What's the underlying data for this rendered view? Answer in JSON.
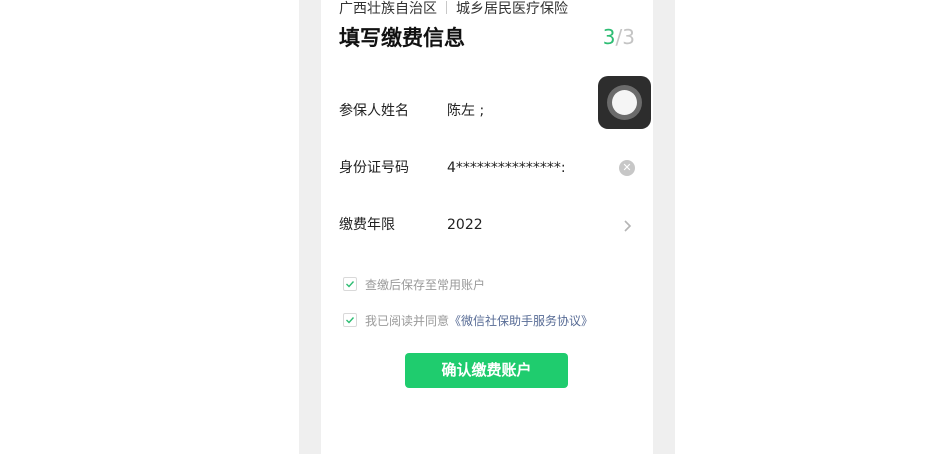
{
  "header": {
    "region": "广西壮族自治区",
    "service": "城乡居民医疗保险",
    "title": "填写缴费信息",
    "step_current": "3",
    "step_total": "/3"
  },
  "form": {
    "fields": [
      {
        "label": "参保人姓名",
        "value": "陈左 ;",
        "action_icon": "clear-icon"
      },
      {
        "label": "身份证号码",
        "value": "4***************:",
        "action_icon": "clear-icon"
      },
      {
        "label": "缴费年限",
        "value": "2022",
        "action_icon": "chevron-right-icon"
      }
    ]
  },
  "options": {
    "save_account": {
      "label": "查缴后保存至常用账户",
      "checked": true
    },
    "agreement": {
      "prefix": "我已阅读并同意",
      "link": "《微信社保助手服务协议》",
      "checked": true
    }
  },
  "confirm_label": "确认缴费账户",
  "colors": {
    "accent": "#1fcc6e",
    "step_active": "#2dbd73",
    "link": "#576b95"
  }
}
